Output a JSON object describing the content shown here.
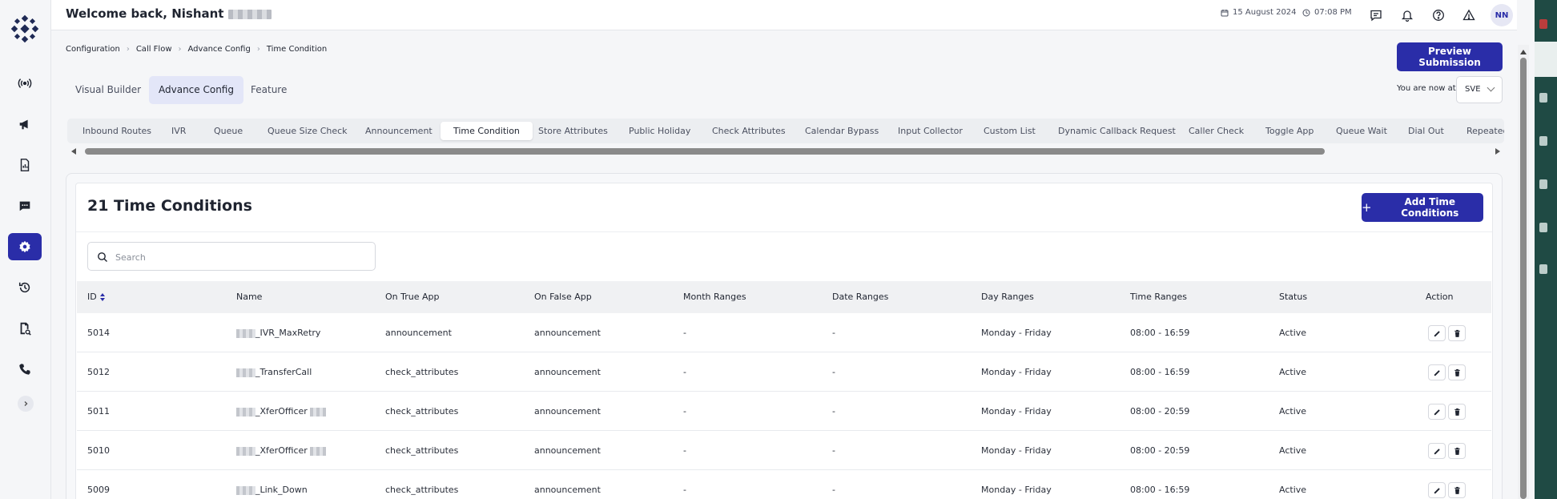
{
  "header": {
    "welcome": "Welcome back, Nishant",
    "date": "15 August 2024",
    "time": "07:08 PM",
    "avatar_initials": "NN"
  },
  "breadcrumb": [
    "Configuration",
    "Call Flow",
    "Advance Config",
    "Time Condition"
  ],
  "preview_button": "Preview Submission",
  "mode_tabs": [
    "Visual Builder",
    "Advance Config",
    "Feature"
  ],
  "active_mode_tab": "Advance Config",
  "location": {
    "label": "You are now at",
    "value": "SVE"
  },
  "app_tabs": [
    "Inbound Routes",
    "IVR",
    "Queue",
    "Queue Size Check",
    "Announcement",
    "Time Condition",
    "Store Attributes",
    "Public Holiday",
    "Check Attributes",
    "Calendar Bypass",
    "Input Collector",
    "Custom List",
    "Dynamic Callback Request",
    "Caller Check",
    "Toggle App",
    "Queue Wait",
    "Dial Out",
    "Repeated"
  ],
  "active_app_tab": "Time Condition",
  "panel": {
    "title": "21 Time Conditions",
    "add_button": "Add Time Conditions",
    "search_placeholder": "Search"
  },
  "table": {
    "columns": [
      "ID",
      "Name",
      "On True App",
      "On False App",
      "Month Ranges",
      "Date Ranges",
      "Day Ranges",
      "Time Ranges",
      "Status",
      "Action"
    ],
    "rows": [
      {
        "id": "5014",
        "name": "_IVR_MaxRetry",
        "name_suffix_redacted": false,
        "on_true": "announcement",
        "on_false": "announcement",
        "month": "-",
        "date": "-",
        "day": "Monday - Friday",
        "time": "08:00 - 16:59",
        "status": "Active"
      },
      {
        "id": "5012",
        "name": "_TransferCall",
        "name_suffix_redacted": false,
        "on_true": "check_attributes",
        "on_false": "announcement",
        "month": "-",
        "date": "-",
        "day": "Monday - Friday",
        "time": "08:00 - 16:59",
        "status": "Active"
      },
      {
        "id": "5011",
        "name": "_XferOfficer",
        "name_suffix_redacted": true,
        "on_true": "check_attributes",
        "on_false": "announcement",
        "month": "-",
        "date": "-",
        "day": "Monday - Friday",
        "time": "08:00 - 20:59",
        "status": "Active"
      },
      {
        "id": "5010",
        "name": "_XferOfficer",
        "name_suffix_redacted": true,
        "on_true": "check_attributes",
        "on_false": "announcement",
        "month": "-",
        "date": "-",
        "day": "Monday - Friday",
        "time": "08:00 - 20:59",
        "status": "Active"
      },
      {
        "id": "5009",
        "name": "_Link_Down",
        "name_suffix_redacted": false,
        "on_true": "check_attributes",
        "on_false": "announcement",
        "month": "-",
        "date": "-",
        "day": "Monday - Friday",
        "time": "08:00 - 16:59",
        "status": "Active"
      }
    ]
  },
  "icons": {
    "rail": [
      "broadcast-icon",
      "megaphone-icon",
      "report-icon",
      "chat-icon",
      "settings-icon",
      "history-icon",
      "search-document-icon",
      "phone-icon"
    ],
    "header": [
      "calendar-icon",
      "clock-icon",
      "message-icon",
      "bell-icon",
      "help-icon",
      "warning-icon"
    ]
  },
  "colors": {
    "primary": "#2a2da8",
    "active_tab_bg": "#e3e6f8"
  }
}
